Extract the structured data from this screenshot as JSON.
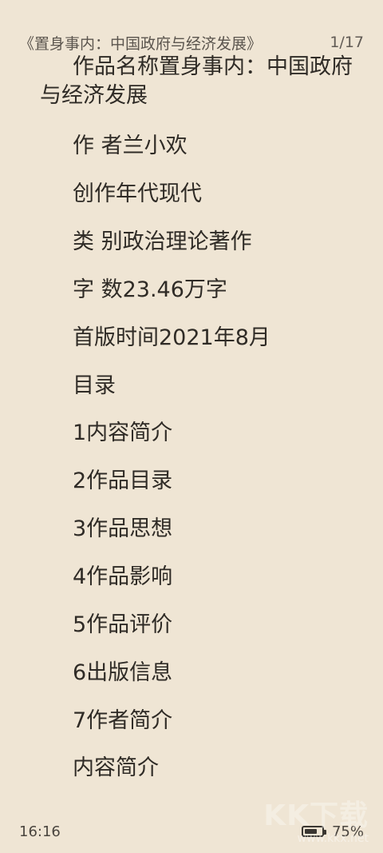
{
  "header": {
    "title": "《置身事内：中国政府与经济发展》",
    "page_indicator": "1/17"
  },
  "content": {
    "paragraphs": [
      "作品名称置身事内：中国政府与经济发展",
      "作 者兰小欢",
      "创作年代现代",
      "类 别政治理论著作",
      "字 数23.46万字",
      "首版时间2021年8月",
      "目录",
      "1内容简介",
      "2作品目录",
      "3作品思想",
      "4作品影响",
      "5作品评价",
      "6出版信息",
      "7作者简介",
      "内容简介"
    ]
  },
  "footer": {
    "time": "16:16",
    "battery_percent": "75%",
    "battery_level": 0.75,
    "icon_name": "battery-icon"
  },
  "watermark": {
    "text": "KK下载",
    "url": "www.kkx.net"
  }
}
